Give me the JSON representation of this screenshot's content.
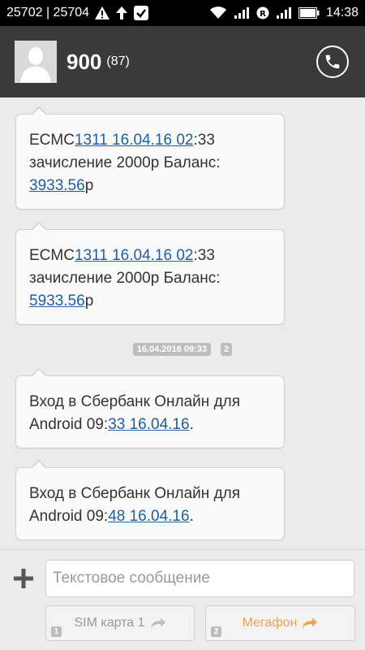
{
  "status_bar": {
    "left_text": "25702 | 25704",
    "time": "14:38",
    "icons": [
      "warning-icon",
      "upload-arrow-icon",
      "check-icon",
      "wifi-icon",
      "signal-icon",
      "roaming-r-icon",
      "signal-icon",
      "battery-icon"
    ]
  },
  "header": {
    "name": "900",
    "count": "(87)",
    "icons": [
      "avatar-icon",
      "phone-icon"
    ]
  },
  "messages": [
    {
      "segments": [
        "ECMC",
        "1311 16.04.16 02",
        ":33 зачисление 2000р Баланс: ",
        "3933.56",
        "р"
      ]
    },
    {
      "segments": [
        "ECMC",
        "1311 16.04.16 02",
        ":33 зачисление 2000р Баланс: ",
        "5933.56",
        "р"
      ]
    },
    {
      "segments": [
        "Вход в Сбербанк Онлайн для Android 09:",
        "33 16.04.16",
        "."
      ]
    },
    {
      "segments": [
        "Вход в Сбербанк Онлайн для Android 09:",
        "48 16.04.16",
        "."
      ]
    }
  ],
  "timestamp": {
    "time": "16.04.2016 09:33",
    "sim": "2"
  },
  "compose": {
    "placeholder": "Текстовое сообщение",
    "value": "",
    "sim1_num": "1",
    "sim1_label": "SIM карта 1",
    "sim2_num": "2",
    "sim2_label": "Мегафон"
  },
  "colors": {
    "link": "#1f5fa0",
    "header_bg": "#3a3a3a",
    "sim2_accent": "#f0a050"
  }
}
